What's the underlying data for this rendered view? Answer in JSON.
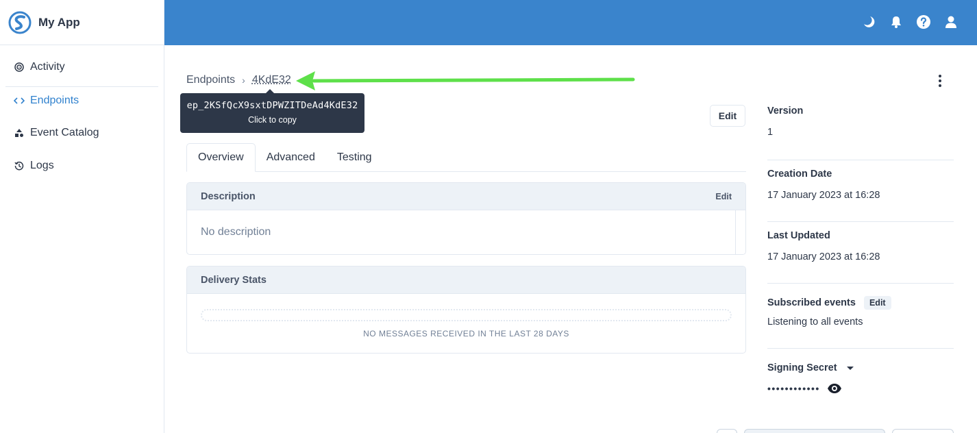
{
  "app": {
    "name": "My App"
  },
  "sidebar": {
    "items": [
      {
        "label": "Activity",
        "icon": "activity-icon",
        "active": false
      },
      {
        "label": "Endpoints",
        "icon": "code-icon",
        "active": true
      },
      {
        "label": "Event Catalog",
        "icon": "shapes-icon",
        "active": false
      },
      {
        "label": "Logs",
        "icon": "history-icon",
        "active": false
      }
    ]
  },
  "topbar": {
    "icons": [
      "moon-icon",
      "bell-icon",
      "help-icon",
      "user-icon"
    ],
    "color": "#3a84cc"
  },
  "breadcrumb": {
    "parent": "Endpoints",
    "current": "4KdE32"
  },
  "tooltip": {
    "id": "ep_2KSfQcX9sxtDPWZITDeAd4KdE32",
    "hint": "Click to copy"
  },
  "header": {
    "edit_label": "Edit"
  },
  "tabs": [
    {
      "label": "Overview",
      "active": true
    },
    {
      "label": "Advanced",
      "active": false
    },
    {
      "label": "Testing",
      "active": false
    }
  ],
  "description": {
    "title": "Description",
    "edit_label": "Edit",
    "body": "No description"
  },
  "delivery_stats": {
    "title": "Delivery Stats",
    "message": "NO MESSAGES RECEIVED IN THE LAST 28 DAYS"
  },
  "details": {
    "version": {
      "label": "Version",
      "value": "1"
    },
    "creation": {
      "label": "Creation Date",
      "value": "17 January 2023 at 16:28"
    },
    "updated": {
      "label": "Last Updated",
      "value": "17 January 2023 at 16:28"
    },
    "subscribed": {
      "label": "Subscribed events",
      "edit_label": "Edit",
      "value": "Listening to all events"
    },
    "secret": {
      "label": "Signing Secret",
      "masked": "••••••••••••"
    }
  },
  "annotation": {
    "arrow_color": "#5ee04a"
  }
}
